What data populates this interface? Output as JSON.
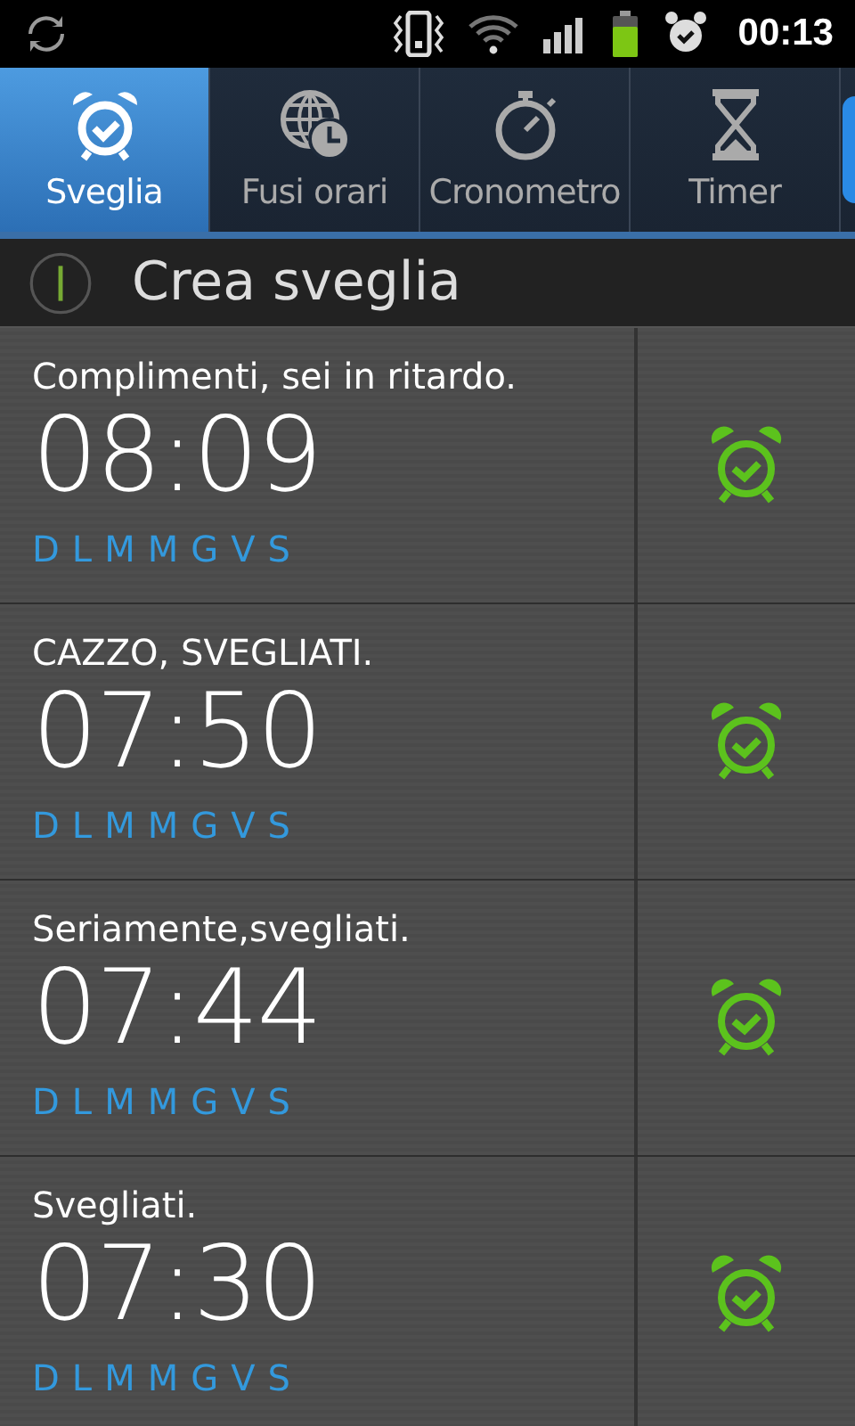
{
  "status_bar": {
    "time": "00:13"
  },
  "tabs": [
    {
      "label": "Sveglia",
      "selected": true
    },
    {
      "label": "Fusi orari",
      "selected": false
    },
    {
      "label": "Cronometro",
      "selected": false
    },
    {
      "label": "Timer",
      "selected": false
    }
  ],
  "create_alarm": {
    "label": "Crea sveglia"
  },
  "alarms": [
    {
      "title": "Complimenti, sei in ritardo.",
      "time": "08:09",
      "enabled": true,
      "days": [
        {
          "label": "D",
          "on": true
        },
        {
          "label": "L",
          "on": true
        },
        {
          "label": "M",
          "on": true
        },
        {
          "label": "M",
          "on": true
        },
        {
          "label": "G",
          "on": true
        },
        {
          "label": "V",
          "on": true
        },
        {
          "label": "S",
          "on": true
        }
      ]
    },
    {
      "title": "CAZZO, SVEGLIATI.",
      "time": "07:50",
      "enabled": true,
      "days": [
        {
          "label": "D",
          "on": true
        },
        {
          "label": "L",
          "on": true
        },
        {
          "label": "M",
          "on": true
        },
        {
          "label": "M",
          "on": true
        },
        {
          "label": "G",
          "on": true
        },
        {
          "label": "V",
          "on": true
        },
        {
          "label": "S",
          "on": true
        }
      ]
    },
    {
      "title": "Seriamente,svegliati.",
      "time": "07:44",
      "enabled": true,
      "days": [
        {
          "label": "D",
          "on": true
        },
        {
          "label": "L",
          "on": true
        },
        {
          "label": "M",
          "on": true
        },
        {
          "label": "M",
          "on": true
        },
        {
          "label": "G",
          "on": true
        },
        {
          "label": "V",
          "on": true
        },
        {
          "label": "S",
          "on": true
        }
      ]
    },
    {
      "title": "Svegliati.",
      "time": "07:30",
      "enabled": true,
      "days": [
        {
          "label": "D",
          "on": true
        },
        {
          "label": "L",
          "on": true
        },
        {
          "label": "M",
          "on": true
        },
        {
          "label": "M",
          "on": true
        },
        {
          "label": "G",
          "on": true
        },
        {
          "label": "V",
          "on": true
        },
        {
          "label": "S",
          "on": true
        }
      ]
    }
  ]
}
